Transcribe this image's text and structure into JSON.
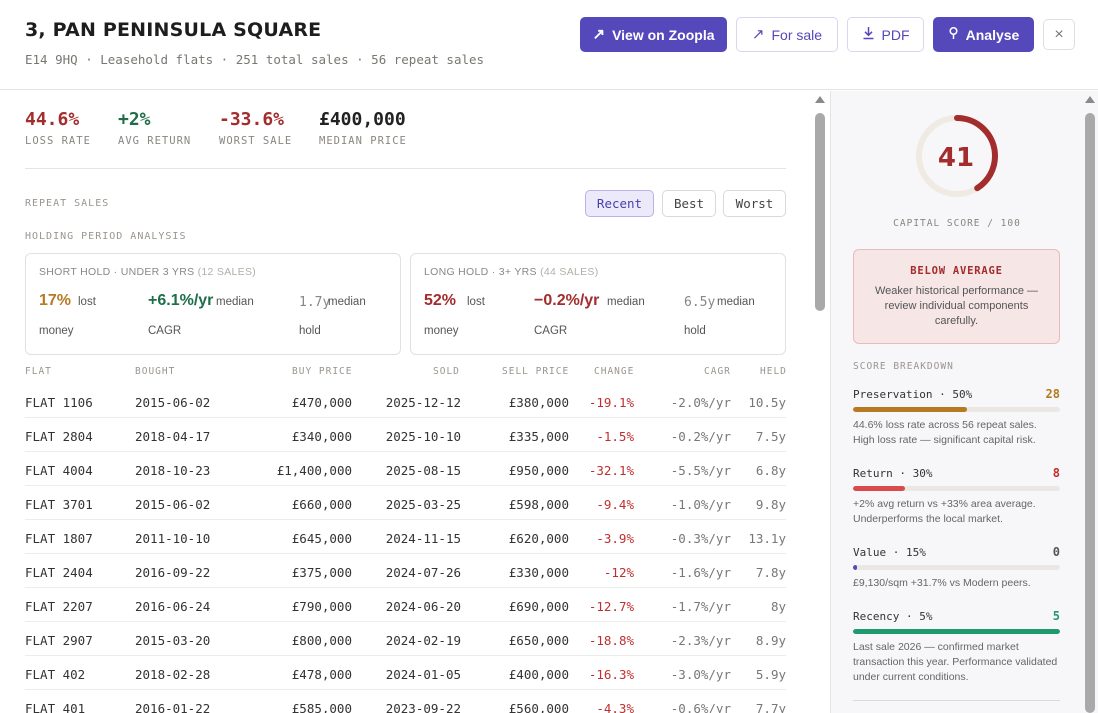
{
  "header": {
    "title": "3, PAN PENINSULA SQUARE",
    "subtitle": "E14 9HQ · Leasehold flats · 251 total sales · 56 repeat sales",
    "buttons": {
      "zoopla": "View on Zoopla",
      "for_sale": "For sale",
      "pdf": "PDF",
      "analyse": "Analyse",
      "close": "×"
    }
  },
  "metrics": [
    {
      "value": "44.6%",
      "label": "LOSS RATE",
      "color": "#a32c2c"
    },
    {
      "value": "+2%",
      "label": "AVG RETURN",
      "color": "#1f6e4a"
    },
    {
      "value": "-33.6%",
      "label": "WORST SALE",
      "color": "#a32c2c"
    },
    {
      "value": "£400,000",
      "label": "MEDIAN PRICE",
      "color": "#222222"
    }
  ],
  "repeat_sales": {
    "label": "REPEAT SALES",
    "toggles": [
      "Recent",
      "Best",
      "Worst"
    ],
    "active": "Recent"
  },
  "holding": {
    "label": "HOLDING PERIOD ANALYSIS",
    "short": {
      "title": "SHORT HOLD · UNDER 3 YRS",
      "count": "(12 SALES)",
      "loss_val": "17%",
      "loss_lbl1": "lost",
      "loss_lbl2": "money",
      "cagr_val": "+6.1%/yr",
      "cagr_lbl1": "median",
      "cagr_lbl2": "CAGR",
      "hold_val": "1.7y",
      "hold_lbl1": "median",
      "hold_lbl2": "hold"
    },
    "long": {
      "title": "LONG HOLD · 3+ YRS",
      "count": "(44 SALES)",
      "loss_val": "52%",
      "loss_lbl1": "lost",
      "loss_lbl2": "money",
      "cagr_val": "−0.2%/yr",
      "cagr_lbl1": "median",
      "cagr_lbl2": "CAGR",
      "hold_val": "6.5y",
      "hold_lbl1": "median",
      "hold_lbl2": "hold"
    }
  },
  "table": {
    "headers": [
      "FLAT",
      "BOUGHT",
      "BUY PRICE",
      "SOLD",
      "SELL PRICE",
      "CHANGE",
      "CAGR",
      "HELD"
    ],
    "rows": [
      [
        "FLAT 1106",
        "2015-06-02",
        "£470,000",
        "2025-12-12",
        "£380,000",
        "-19.1%",
        "-2.0%/yr",
        "10.5y"
      ],
      [
        "FLAT 2804",
        "2018-04-17",
        "£340,000",
        "2025-10-10",
        "£335,000",
        "-1.5%",
        "-0.2%/yr",
        "7.5y"
      ],
      [
        "FLAT 4004",
        "2018-10-23",
        "£1,400,000",
        "2025-08-15",
        "£950,000",
        "-32.1%",
        "-5.5%/yr",
        "6.8y"
      ],
      [
        "FLAT 3701",
        "2015-06-02",
        "£660,000",
        "2025-03-25",
        "£598,000",
        "-9.4%",
        "-1.0%/yr",
        "9.8y"
      ],
      [
        "FLAT 1807",
        "2011-10-10",
        "£645,000",
        "2024-11-15",
        "£620,000",
        "-3.9%",
        "-0.3%/yr",
        "13.1y"
      ],
      [
        "FLAT 2404",
        "2016-09-22",
        "£375,000",
        "2024-07-26",
        "£330,000",
        "-12%",
        "-1.6%/yr",
        "7.8y"
      ],
      [
        "FLAT 2207",
        "2016-06-24",
        "£790,000",
        "2024-06-20",
        "£690,000",
        "-12.7%",
        "-1.7%/yr",
        "8y"
      ],
      [
        "FLAT 2907",
        "2015-03-20",
        "£800,000",
        "2024-02-19",
        "£650,000",
        "-18.8%",
        "-2.3%/yr",
        "8.9y"
      ],
      [
        "FLAT 402",
        "2018-02-28",
        "£478,000",
        "2024-01-05",
        "£400,000",
        "-16.3%",
        "-3.0%/yr",
        "5.9y"
      ],
      [
        "FLAT 401",
        "2016-01-22",
        "£585,000",
        "2023-09-22",
        "£560,000",
        "-4.3%",
        "-0.6%/yr",
        "7.7y"
      ]
    ]
  },
  "score": {
    "value": "41",
    "max": 100,
    "label": "CAPITAL SCORE / 100",
    "ring_color": "#a32c2c",
    "verdict_title": "BELOW AVERAGE",
    "verdict_desc": "Weaker historical performance — review individual components carefully.",
    "breakdown_label": "SCORE BREAKDOWN",
    "components": [
      {
        "name": "Preservation · 50%",
        "value": "28",
        "fraction": 0.55,
        "color": "#b57a22",
        "desc": "44.6% loss rate across 56 repeat sales. High loss rate — significant capital risk."
      },
      {
        "name": "Return · 30%",
        "value": "8",
        "fraction": 0.25,
        "color": "#d94a4a",
        "desc": "+2% avg return vs +33% area average. Underperforms the local market."
      },
      {
        "name": "Value · 15%",
        "value": "0",
        "fraction": 0.02,
        "color": "#5548bb",
        "desc": "£9,130/sqm +31.7% vs Modern peers."
      },
      {
        "name": "Recency · 5%",
        "value": "5",
        "fraction": 1.0,
        "color": "#1f9a6e",
        "desc": "Last sale 2026 — confirmed market transaction this year. Performance validated under current conditions."
      }
    ]
  }
}
